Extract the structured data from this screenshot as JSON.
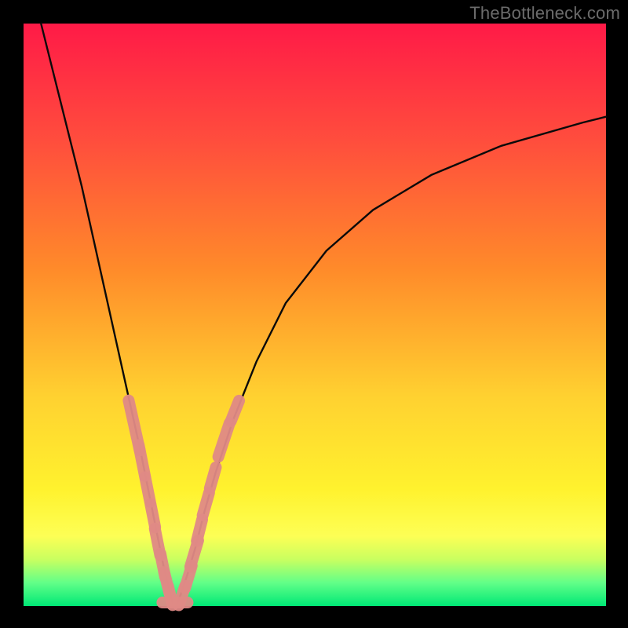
{
  "watermark": "TheBottleneck.com",
  "colors": {
    "curve_stroke": "#0a0a0a",
    "marker_fill": "#e08a86",
    "marker_stroke": "#d47a76"
  },
  "frame": {
    "outer_w": 800,
    "outer_h": 800,
    "inner_x": 30,
    "inner_y": 30,
    "inner_w": 742,
    "inner_h": 742
  },
  "chart_data": {
    "type": "line",
    "title": "",
    "xlabel": "",
    "ylabel": "",
    "xlim": [
      0,
      100
    ],
    "ylim": [
      0,
      100
    ],
    "note": "V-shaped bottleneck curve. x is relative component balance (arbitrary 0-100); y is bottleneck percentage (0 = no bottleneck at valley). Values estimated from gridlines/pixels.",
    "series": [
      {
        "name": "left-branch",
        "x": [
          3,
          5,
          8,
          10,
          12,
          14,
          16,
          18,
          20,
          22,
          23,
          24,
          25,
          25.6
        ],
        "y": [
          100,
          92,
          80,
          72,
          63,
          54,
          45,
          36,
          27,
          17,
          12,
          7,
          3,
          0.5
        ]
      },
      {
        "name": "right-branch",
        "x": [
          26.4,
          27,
          28,
          29.5,
          31,
          33,
          36,
          40,
          45,
          52,
          60,
          70,
          82,
          96,
          100
        ],
        "y": [
          0.5,
          2,
          5,
          10,
          16,
          23,
          32,
          42,
          52,
          61,
          68,
          74,
          79,
          83,
          84
        ]
      }
    ],
    "markers": {
      "name": "highlighted-segments",
      "note": "Pink lozenge markers laid along the curve near the valley region, estimated positions.",
      "points": [
        {
          "branch": "left",
          "x": 19.0,
          "y": 31.0,
          "len": 6.5
        },
        {
          "branch": "left",
          "x": 20.3,
          "y": 25.0,
          "len": 4.0
        },
        {
          "branch": "left",
          "x": 21.3,
          "y": 20.0,
          "len": 3.2
        },
        {
          "branch": "left",
          "x": 22.2,
          "y": 15.5,
          "len": 3.0
        },
        {
          "branch": "left",
          "x": 23.0,
          "y": 11.0,
          "len": 3.5
        },
        {
          "branch": "left",
          "x": 23.9,
          "y": 7.0,
          "len": 3.0
        },
        {
          "branch": "left",
          "x": 24.6,
          "y": 4.0,
          "len": 2.8
        },
        {
          "branch": "left",
          "x": 25.2,
          "y": 1.8,
          "len": 2.5
        },
        {
          "branch": "flat",
          "x": 26.0,
          "y": 0.6,
          "len": 3.2
        },
        {
          "branch": "right",
          "x": 27.2,
          "y": 1.8,
          "len": 2.6
        },
        {
          "branch": "right",
          "x": 28.3,
          "y": 5.0,
          "len": 3.0
        },
        {
          "branch": "right",
          "x": 29.3,
          "y": 9.0,
          "len": 3.5
        },
        {
          "branch": "right",
          "x": 30.2,
          "y": 13.0,
          "len": 2.8
        },
        {
          "branch": "right",
          "x": 31.3,
          "y": 17.5,
          "len": 3.0
        },
        {
          "branch": "right",
          "x": 32.5,
          "y": 22.0,
          "len": 2.8
        },
        {
          "branch": "right",
          "x": 34.4,
          "y": 28.5,
          "len": 4.5
        },
        {
          "branch": "right",
          "x": 36.3,
          "y": 33.5,
          "len": 2.8
        }
      ]
    }
  }
}
